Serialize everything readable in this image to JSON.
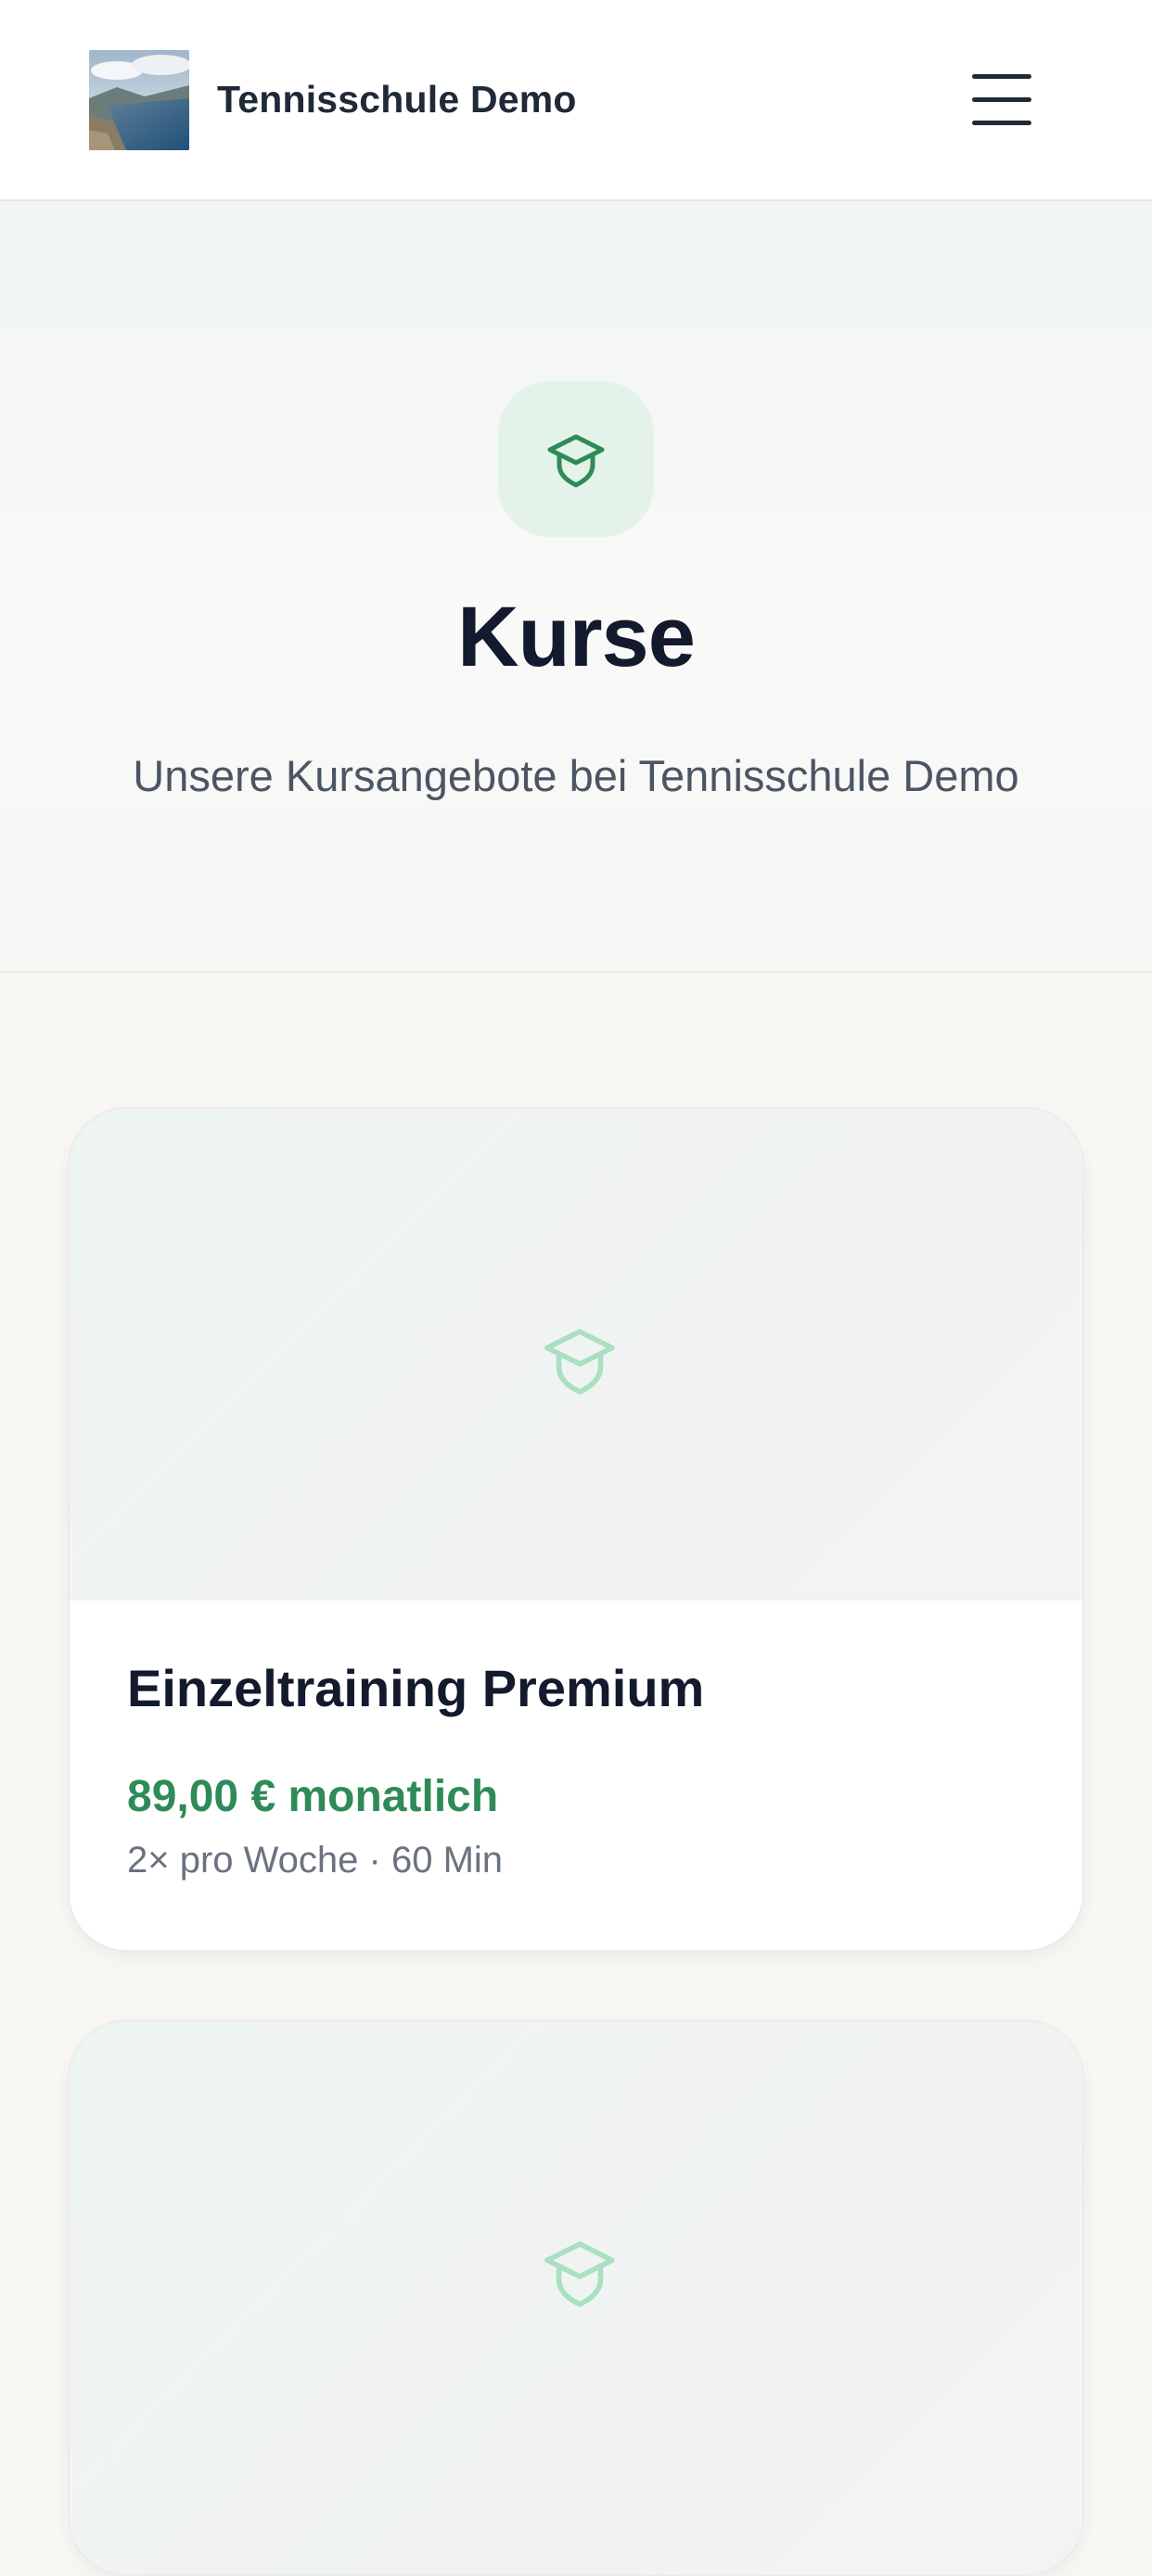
{
  "header": {
    "brand": "Tennisschule Demo",
    "logo_icon": "landscape-photo-logo",
    "menu_icon": "hamburger-menu-icon"
  },
  "hero": {
    "icon": "graduation-cap-icon",
    "title": "Kurse",
    "subtitle": "Unsere Kursangebote bei Tennisschule Demo"
  },
  "courses": [
    {
      "icon": "graduation-cap-icon",
      "title": "Einzeltraining Premium",
      "price": "89,00 € monatlich",
      "meta": "2× pro Woche · 60 Min"
    },
    {
      "icon": "graduation-cap-icon"
    }
  ],
  "colors": {
    "accent": "#2e8b57",
    "accent_light": "#e3f3ea",
    "heading": "#131a2e",
    "muted": "#6b7280"
  }
}
